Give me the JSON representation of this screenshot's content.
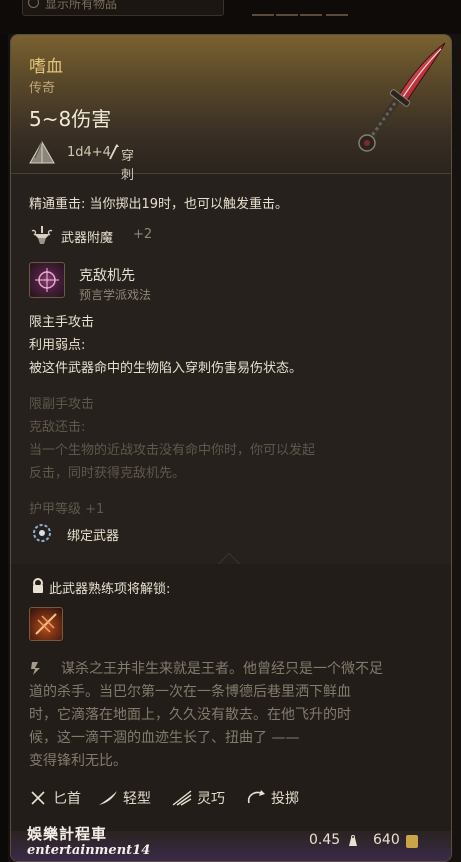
{
  "search": {
    "placeholder": "显示所有物品"
  },
  "item": {
    "name": "嗜血",
    "rarity": "传奇",
    "damage": "5~8伤害",
    "dice": "1d4+4",
    "damage_type": "穿刺"
  },
  "properties": {
    "crit": "精通重击: 当你掷出19时，也可以触发重击。",
    "enchant_label": "武器附魔",
    "enchant_value": "+2",
    "spell_name": "克敌机先",
    "spell_school": "预言学派戏法",
    "main_hand_only": "限主手攻击",
    "exploit_title": "利用弱点:",
    "exploit_desc": "被这件武器命中的生物陷入穿刺伤害易伤状态。",
    "offhand_only": "限副手攻击",
    "riposte_title": "克敌还击:",
    "riposte_desc_1": "当一个生物的近战攻击没有命中你时，你可以发起",
    "riposte_desc_2": "反击，同时获得克敌机先。",
    "ac_label": "护甲等级 +1",
    "bind_label": "绑定武器"
  },
  "proficiency": {
    "label": "此武器熟练项将解锁:"
  },
  "lore": [
    "谋杀之王并非生来就是王者。他曾经只是一个微不足",
    "道的杀手。当巴尔第一次在一条博德后巷里洒下鲜血",
    "时，它滴落在地面上，久久没有散去。在他飞升的时",
    "候，这一滴干涸的血迹生长了、扭曲了 ——",
    "变得锋利无比。"
  ],
  "tags": [
    "匕首",
    "轻型",
    "灵巧",
    "投掷"
  ],
  "stats": {
    "weight": "0.45",
    "value": "640"
  },
  "watermark": {
    "line1": "娛樂計程車",
    "line2": "entertainment14"
  },
  "colors": {
    "legendary": "#e3c27a",
    "text": "#e7dfcf",
    "muted": "#8f8576"
  },
  "icons": {
    "dice": "d4-icon",
    "piercing": "piercing-icon",
    "enchant": "anvil-icon",
    "spell": "spell-icon",
    "bind": "bind-icon",
    "lock": "lock-icon",
    "proficiency": "proficiency-icon",
    "quote": "quote-icon",
    "dagger": "dagger-icon",
    "light": "feather-icon",
    "finesse": "finesse-icon",
    "thrown": "thrown-icon",
    "weight": "weight-icon",
    "gold": "gold-icon"
  }
}
